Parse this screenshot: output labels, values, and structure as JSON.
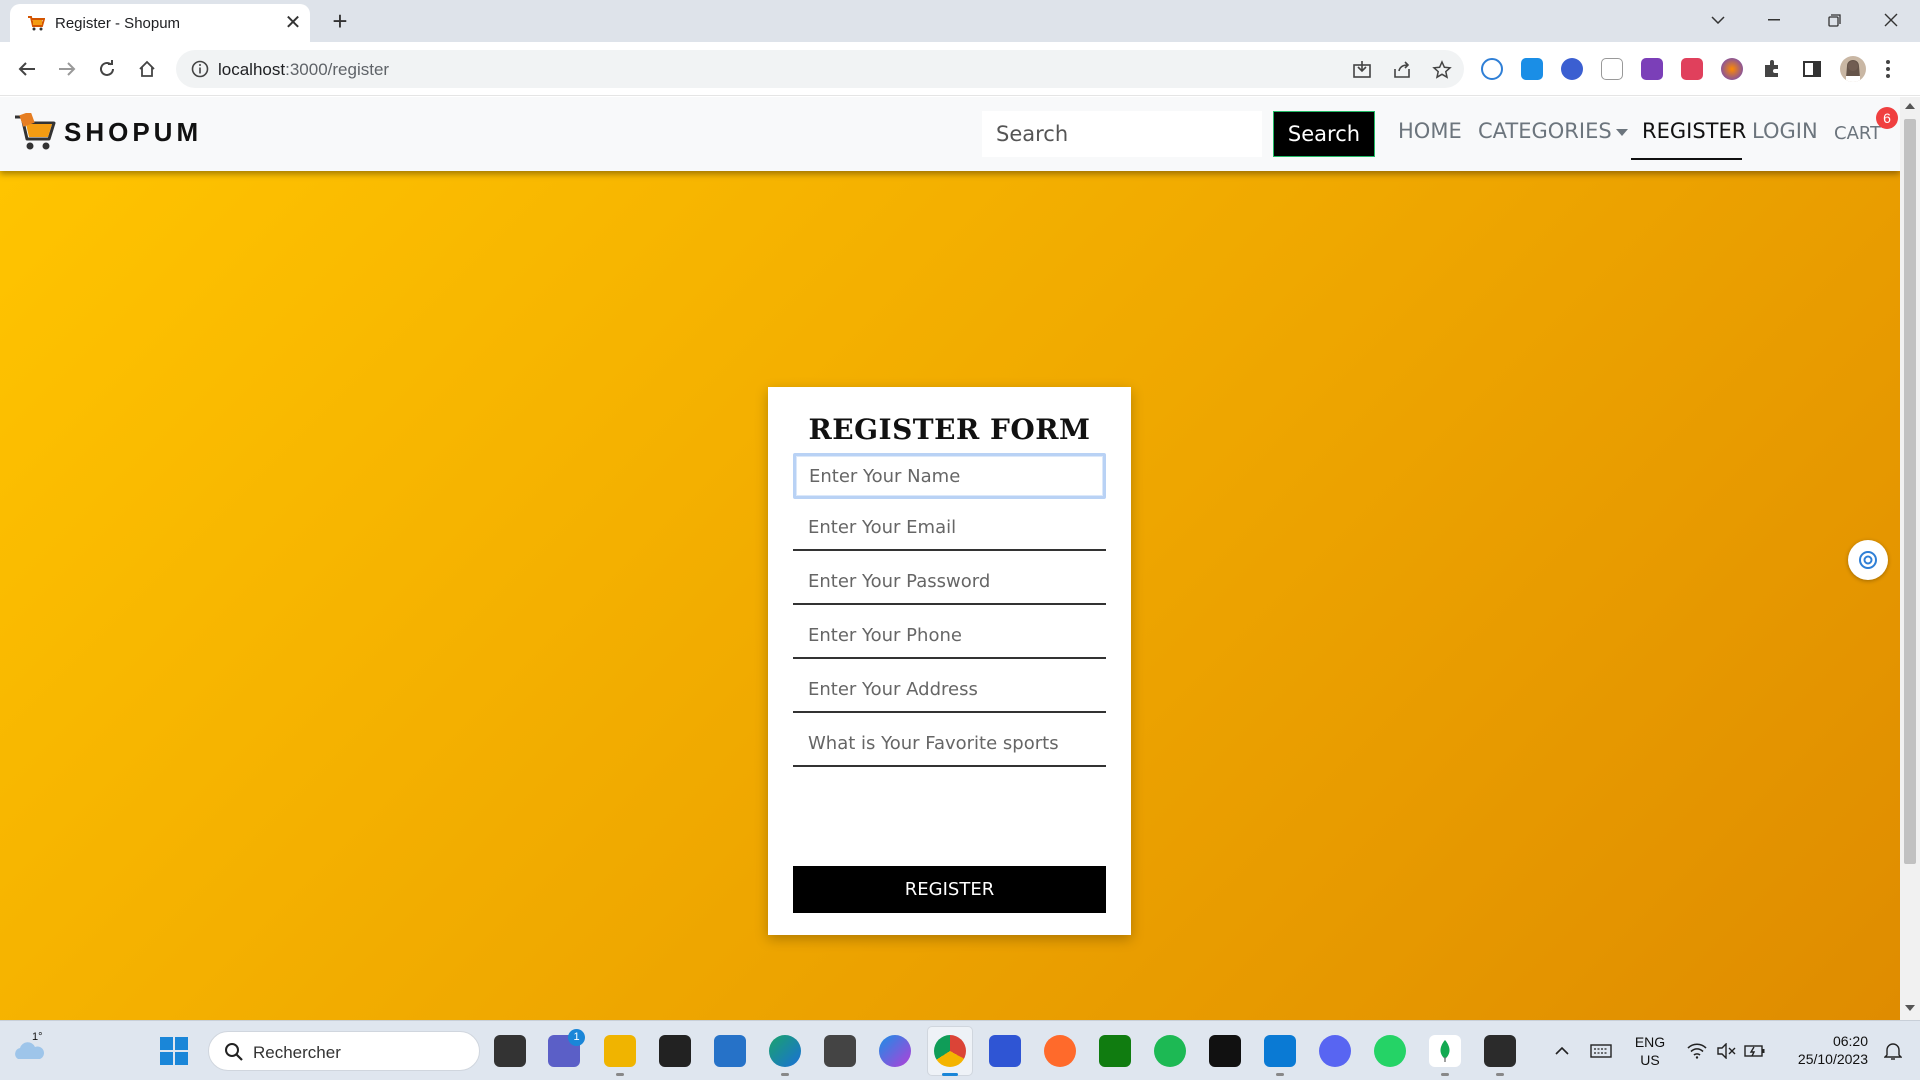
{
  "browser": {
    "tab_title": "Register - Shopum",
    "tab_close": "✕",
    "new_tab": "+",
    "url_host": "localhost",
    "url_rest": ":3000/register"
  },
  "navbar": {
    "brand": "SHOPUM",
    "search_placeholder": "Search",
    "search_button": "Search",
    "links": {
      "home": "HOME",
      "categories": "CATEGORIES",
      "register": "REGISTER",
      "login": "LOGIN",
      "cart": "CART"
    },
    "cart_count": "6",
    "active_link": "register"
  },
  "register_form": {
    "title": "REGISTER FORM",
    "fields": {
      "name": "Enter Your Name",
      "email": "Enter Your Email",
      "password": "Enter Your Password",
      "phone": "Enter Your Phone",
      "address": "Enter Your Address",
      "sports": "What is Your Favorite sports"
    },
    "submit": "REGISTER"
  },
  "taskbar": {
    "weather": "1°",
    "search_text": "Rechercher",
    "teams_badge": "1",
    "language": "ENG",
    "region": "US",
    "time": "06:20",
    "date": "25/10/2023"
  },
  "colors": {
    "hero_start": "#ffc400",
    "hero_end": "#df8c00",
    "cart_badge": "#f04040",
    "button_bg": "#000000"
  }
}
